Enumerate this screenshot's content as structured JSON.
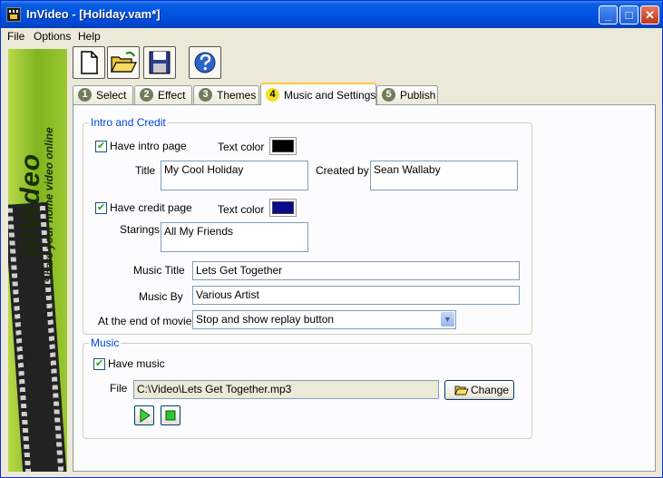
{
  "window": {
    "title": "InVideo - [Holiday.vam*]",
    "min_glyph": "_",
    "max_glyph": "□",
    "close_glyph": "✕"
  },
  "menu": {
    "items": [
      "File",
      "Options",
      "Help"
    ]
  },
  "toolbar": {
    "icons": [
      "new-document-icon",
      "open-folder-icon",
      "save-disk-icon",
      "help-icon"
    ]
  },
  "sidebar": {
    "brand": "inVideo",
    "tagline": "Share your home video online"
  },
  "tabs": [
    {
      "num": "1",
      "label": "Select"
    },
    {
      "num": "2",
      "label": "Effect"
    },
    {
      "num": "3",
      "label": "Themes"
    },
    {
      "num": "4",
      "label": "Music and Settings"
    },
    {
      "num": "5",
      "label": "Publish"
    }
  ],
  "intro": {
    "group_title": "Intro and Credit",
    "have_intro_label": "Have intro page",
    "have_intro_checked": true,
    "text_color_label": "Text color",
    "intro_text_color": "#000000",
    "title_label": "Title",
    "title_value": "My Cool Holiday",
    "created_by_label": "Created by",
    "created_by_value": "Sean Wallaby",
    "have_credit_label": "Have credit page",
    "have_credit_checked": true,
    "credit_text_color": "#0a0a8c",
    "starings_label": "Starings",
    "starings_value": "All My Friends",
    "music_title_label": "Music Title",
    "music_title_value": "Lets Get Together",
    "music_by_label": "Music By",
    "music_by_value": "Various Artist",
    "end_label": "At the end of movie",
    "end_value": "Stop and show replay button"
  },
  "music": {
    "group_title": "Music",
    "have_music_label": "Have music",
    "have_music_checked": true,
    "file_label": "File",
    "file_value": "C:\\Video\\Lets Get Together.mp3",
    "change_label": "Change"
  },
  "colors": {
    "title_bar": "#0054e3",
    "accent": "#0046d5",
    "tab_highlight": "#ffc83c",
    "sidebar_green": "#8cbf2a"
  }
}
